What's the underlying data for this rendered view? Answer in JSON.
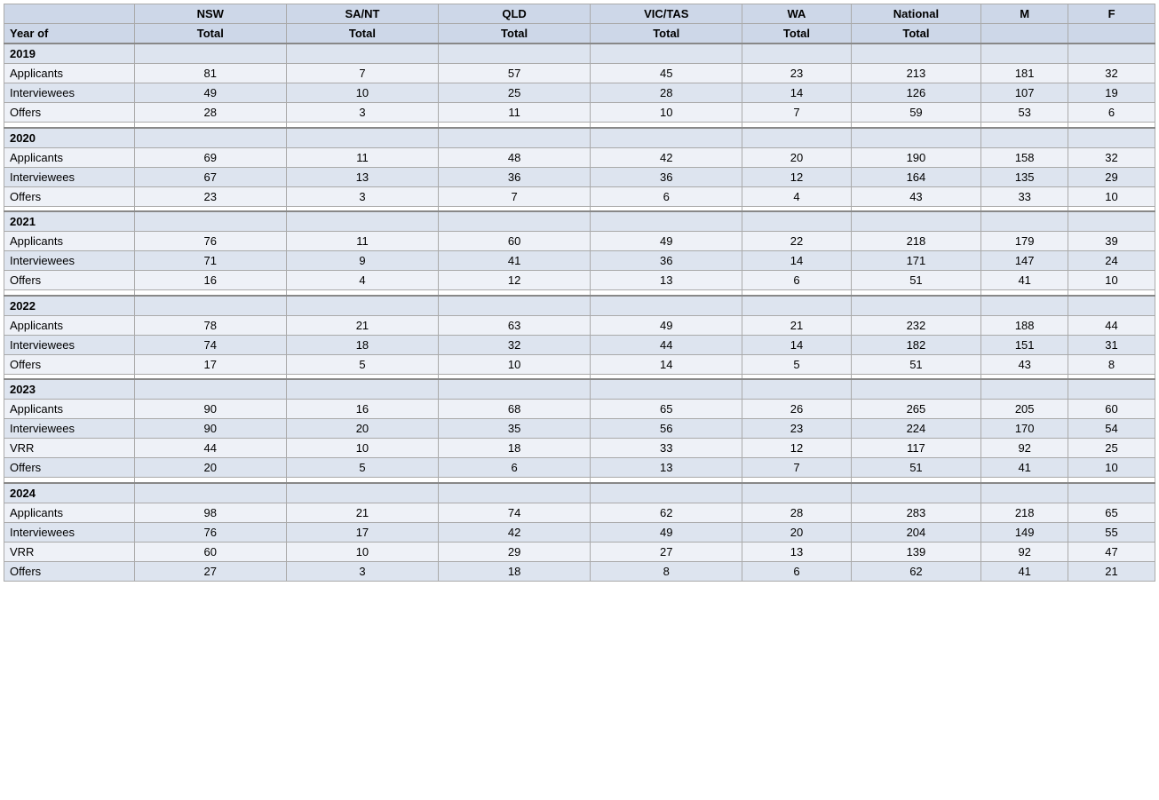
{
  "headers": {
    "col1": "",
    "nsw": "NSW",
    "sant": "SA/NT",
    "qld": "QLD",
    "victas": "VIC/TAS",
    "wa": "WA",
    "national": "National",
    "m": "M",
    "f": "F",
    "sub_label": "Year of",
    "sub_total": "Total"
  },
  "years": [
    {
      "year": "2019",
      "rows": [
        {
          "label": "Applicants",
          "nsw": 81,
          "sant": 7,
          "qld": 57,
          "victas": 45,
          "wa": 23,
          "nat": 213,
          "m": 181,
          "f": 32
        },
        {
          "label": "Interviewees",
          "nsw": 49,
          "sant": 10,
          "qld": 25,
          "victas": 28,
          "wa": 14,
          "nat": 126,
          "m": 107,
          "f": 19
        },
        {
          "label": "Offers",
          "nsw": 28,
          "sant": 3,
          "qld": 11,
          "victas": 10,
          "wa": 7,
          "nat": 59,
          "m": 53,
          "f": 6
        }
      ]
    },
    {
      "year": "2020",
      "rows": [
        {
          "label": "Applicants",
          "nsw": 69,
          "sant": 11,
          "qld": 48,
          "victas": 42,
          "wa": 20,
          "nat": 190,
          "m": 158,
          "f": 32
        },
        {
          "label": "Interviewees",
          "nsw": 67,
          "sant": 13,
          "qld": 36,
          "victas": 36,
          "wa": 12,
          "nat": 164,
          "m": 135,
          "f": 29
        },
        {
          "label": "Offers",
          "nsw": 23,
          "sant": 3,
          "qld": 7,
          "victas": 6,
          "wa": 4,
          "nat": 43,
          "m": 33,
          "f": 10
        }
      ]
    },
    {
      "year": "2021",
      "rows": [
        {
          "label": "Applicants",
          "nsw": 76,
          "sant": 11,
          "qld": 60,
          "victas": 49,
          "wa": 22,
          "nat": 218,
          "m": 179,
          "f": 39
        },
        {
          "label": "Interviewees",
          "nsw": 71,
          "sant": 9,
          "qld": 41,
          "victas": 36,
          "wa": 14,
          "nat": 171,
          "m": 147,
          "f": 24
        },
        {
          "label": "Offers",
          "nsw": 16,
          "sant": 4,
          "qld": 12,
          "victas": 13,
          "wa": 6,
          "nat": 51,
          "m": 41,
          "f": 10
        }
      ]
    },
    {
      "year": "2022",
      "rows": [
        {
          "label": "Applicants",
          "nsw": 78,
          "sant": 21,
          "qld": 63,
          "victas": 49,
          "wa": 21,
          "nat": 232,
          "m": 188,
          "f": 44
        },
        {
          "label": "Interviewees",
          "nsw": 74,
          "sant": 18,
          "qld": 32,
          "victas": 44,
          "wa": 14,
          "nat": 182,
          "m": 151,
          "f": 31
        },
        {
          "label": "Offers",
          "nsw": 17,
          "sant": 5,
          "qld": 10,
          "victas": 14,
          "wa": 5,
          "nat": 51,
          "m": 43,
          "f": 8
        }
      ]
    },
    {
      "year": "2023",
      "rows": [
        {
          "label": "Applicants",
          "nsw": 90,
          "sant": 16,
          "qld": 68,
          "victas": 65,
          "wa": 26,
          "nat": 265,
          "m": 205,
          "f": 60
        },
        {
          "label": "Interviewees",
          "nsw": 90,
          "sant": 20,
          "qld": 35,
          "victas": 56,
          "wa": 23,
          "nat": 224,
          "m": 170,
          "f": 54
        },
        {
          "label": "VRR",
          "nsw": 44,
          "sant": 10,
          "qld": 18,
          "victas": 33,
          "wa": 12,
          "nat": 117,
          "m": 92,
          "f": 25
        },
        {
          "label": "Offers",
          "nsw": 20,
          "sant": 5,
          "qld": 6,
          "victas": 13,
          "wa": 7,
          "nat": 51,
          "m": 41,
          "f": 10
        }
      ]
    },
    {
      "year": "2024",
      "rows": [
        {
          "label": "Applicants",
          "nsw": 98,
          "sant": 21,
          "qld": 74,
          "victas": 62,
          "wa": 28,
          "nat": 283,
          "m": 218,
          "f": 65
        },
        {
          "label": "Interviewees",
          "nsw": 76,
          "sant": 17,
          "qld": 42,
          "victas": 49,
          "wa": 20,
          "nat": 204,
          "m": 149,
          "f": 55
        },
        {
          "label": "VRR",
          "nsw": 60,
          "sant": 10,
          "qld": 29,
          "victas": 27,
          "wa": 13,
          "nat": 139,
          "m": 92,
          "f": 47
        },
        {
          "label": "Offers",
          "nsw": 27,
          "sant": 3,
          "qld": 18,
          "victas": 8,
          "wa": 6,
          "nat": 62,
          "m": 41,
          "f": 21
        }
      ]
    }
  ]
}
